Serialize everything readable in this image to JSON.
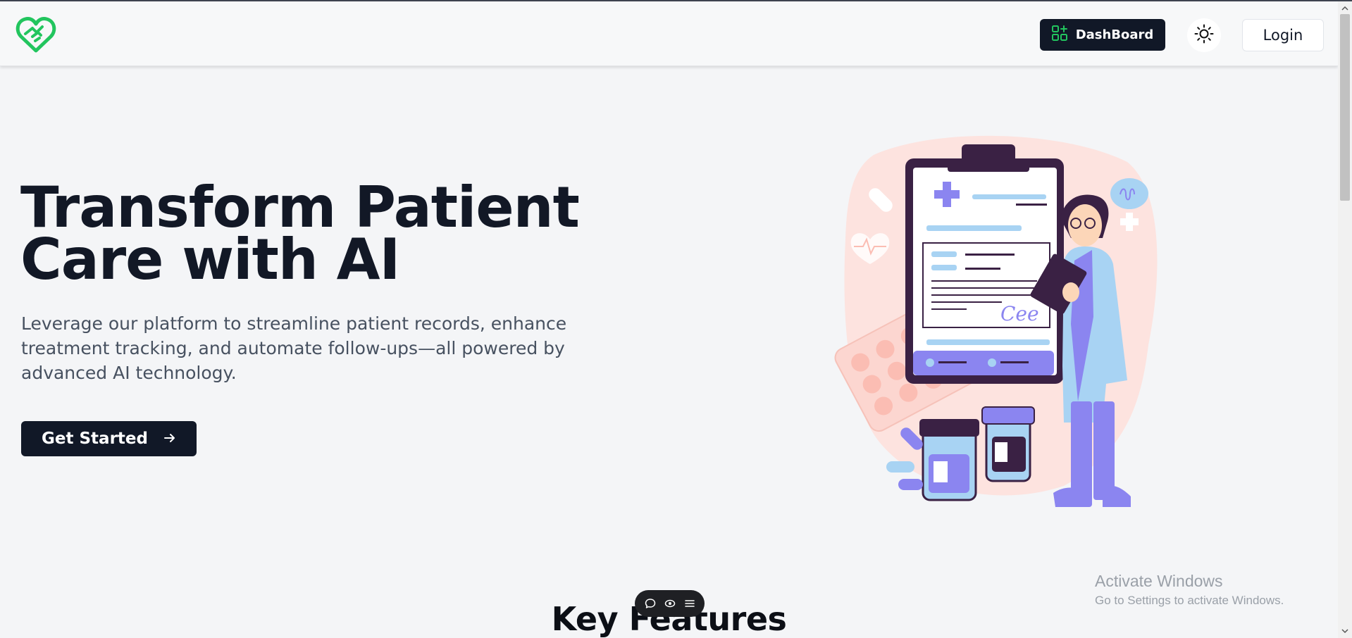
{
  "nav": {
    "dashboard_label": "DashBoard",
    "login_label": "Login"
  },
  "hero": {
    "title_line1": "Transform Patient",
    "title_line2": "Care with AI",
    "description": "Leverage our platform to streamline patient records, enhance treatment tracking, and automate follow-ups—all powered by advanced AI technology.",
    "cta_label": "Get Started"
  },
  "features": {
    "title": "Key Features"
  },
  "illustration": {
    "signature": "Cee"
  },
  "watermark": {
    "title": "Activate Windows",
    "subtitle": "Go to Settings to activate Windows."
  },
  "colors": {
    "brand_green": "#22c55e",
    "dark": "#111827",
    "accent_purple": "#8b85f0",
    "illustration_bg": "#fde3df"
  },
  "icons": {
    "logo": "heart-logo-icon",
    "dashboard": "dashboard-grid-icon",
    "theme": "sun-icon",
    "cta": "arrow-right-icon",
    "toolbar": [
      "comment-icon",
      "eye-icon",
      "menu-icon"
    ]
  }
}
